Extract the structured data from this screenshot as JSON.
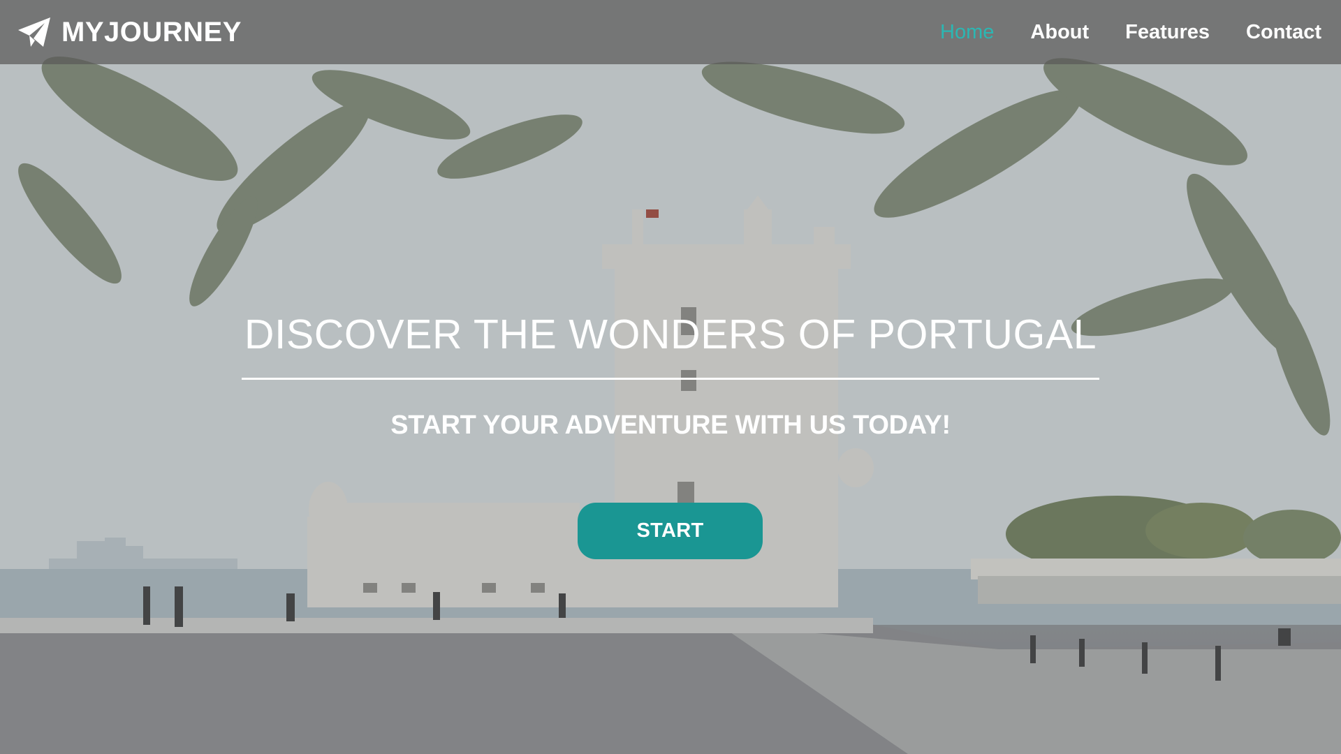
{
  "navbar": {
    "brand_name": "MYJOURNEY",
    "brand_icon": "paper-plane-icon",
    "links": [
      {
        "label": "Home",
        "active": true
      },
      {
        "label": "About",
        "active": false
      },
      {
        "label": "Features",
        "active": false
      },
      {
        "label": "Contact",
        "active": false
      }
    ]
  },
  "hero": {
    "title": "DISCOVER THE WONDERS OF PORTUGAL",
    "subtitle": "START YOUR ADVENTURE WITH US TODAY!",
    "cta_label": "START",
    "background_description_icon": "tower-landscape-background"
  },
  "colors": {
    "accent": "#2bb7b3",
    "button": "#1a9693",
    "navbar_bg": "#5a5a58"
  }
}
